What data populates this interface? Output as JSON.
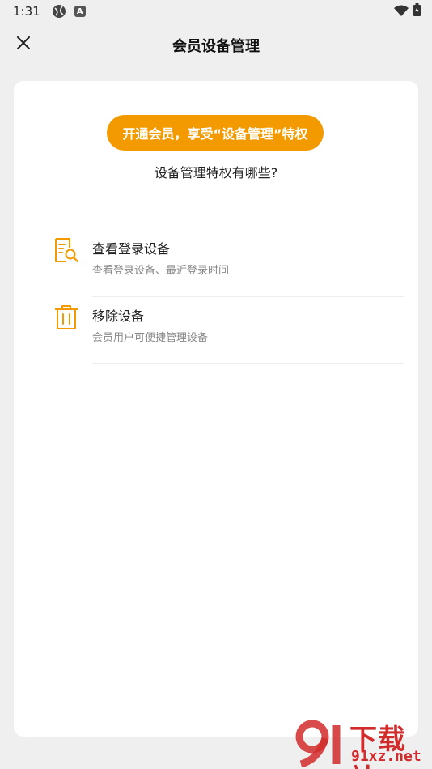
{
  "status_bar": {
    "time": "1:31",
    "icons": [
      "globe-icon",
      "a-badge-icon",
      "wifi-icon",
      "battery-icon"
    ],
    "a_badge": "A"
  },
  "header": {
    "title": "会员设备管理",
    "close_icon": "close-icon"
  },
  "card": {
    "cta_label": "开通会员，享受“设备管理”特权",
    "subtitle": "设备管理特权有哪些?",
    "features": [
      {
        "icon": "document-search-icon",
        "title": "查看登录设备",
        "desc": "查看登录设备、最近登录时间"
      },
      {
        "icon": "trash-icon",
        "title": "移除设备",
        "desc": "会员用户可便捷管理设备"
      }
    ]
  },
  "watermark": {
    "logo_text": "91",
    "top_text": "下载站",
    "bottom_text": "91xz.net"
  },
  "colors": {
    "accent": "#f39a00",
    "background": "#efefef",
    "card": "#ffffff",
    "watermark": "#d22b2b"
  }
}
